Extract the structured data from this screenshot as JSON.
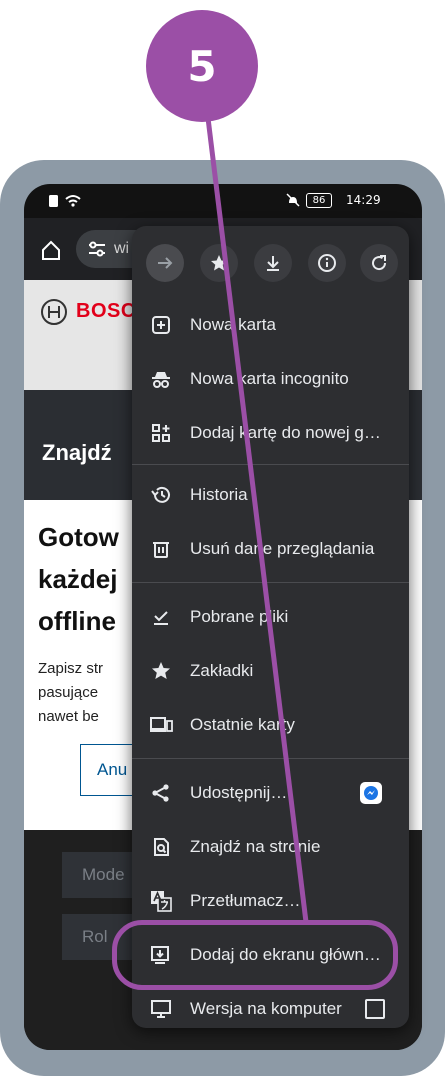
{
  "annotation": {
    "step_number": "5",
    "color": "#9b4fa6"
  },
  "status_bar": {
    "time": "14:29",
    "battery": "86"
  },
  "browser": {
    "address_text": "wi",
    "toolbar_icons": [
      "home-icon",
      "site-settings-icon"
    ]
  },
  "page": {
    "brand": "BOSC",
    "heading": "Znajdź",
    "dialog": {
      "title_lines": [
        "Gotow",
        "każdej",
        "offline"
      ],
      "body_lines": [
        "Zapisz str",
        "pasujące",
        "nawet be"
      ],
      "cancel_label": "Anu"
    },
    "below_buttons": [
      "Mode",
      "Rol"
    ]
  },
  "menu": {
    "top_icons": [
      "forward-icon",
      "bookmark-star-icon",
      "download-icon",
      "info-icon",
      "refresh-icon"
    ],
    "items": [
      {
        "label": "Nowa karta",
        "icon": "new-tab-icon"
      },
      {
        "label": "Nowa karta incognito",
        "icon": "incognito-icon"
      },
      {
        "label": "Dodaj kartę do nowej g…",
        "icon": "tab-group-icon"
      },
      {
        "label": "Historia",
        "icon": "history-icon"
      },
      {
        "label": "Usuń dane przeglądania",
        "icon": "trash-icon"
      },
      {
        "label": "Pobrane pliki",
        "icon": "downloads-icon"
      },
      {
        "label": "Zakładki",
        "icon": "star-icon"
      },
      {
        "label": "Ostatnie karty",
        "icon": "devices-icon"
      },
      {
        "label": "Udostępnij…",
        "icon": "share-icon"
      },
      {
        "label": "Znajdź na stronie",
        "icon": "find-in-page-icon"
      },
      {
        "label": "Przetłumacz…",
        "icon": "translate-icon"
      },
      {
        "label": "Dodaj do ekranu głównego…",
        "icon": "add-to-home-icon"
      },
      {
        "label": "Wersja na komputer",
        "icon": "desktop-icon"
      }
    ],
    "desktop_checked": false
  }
}
